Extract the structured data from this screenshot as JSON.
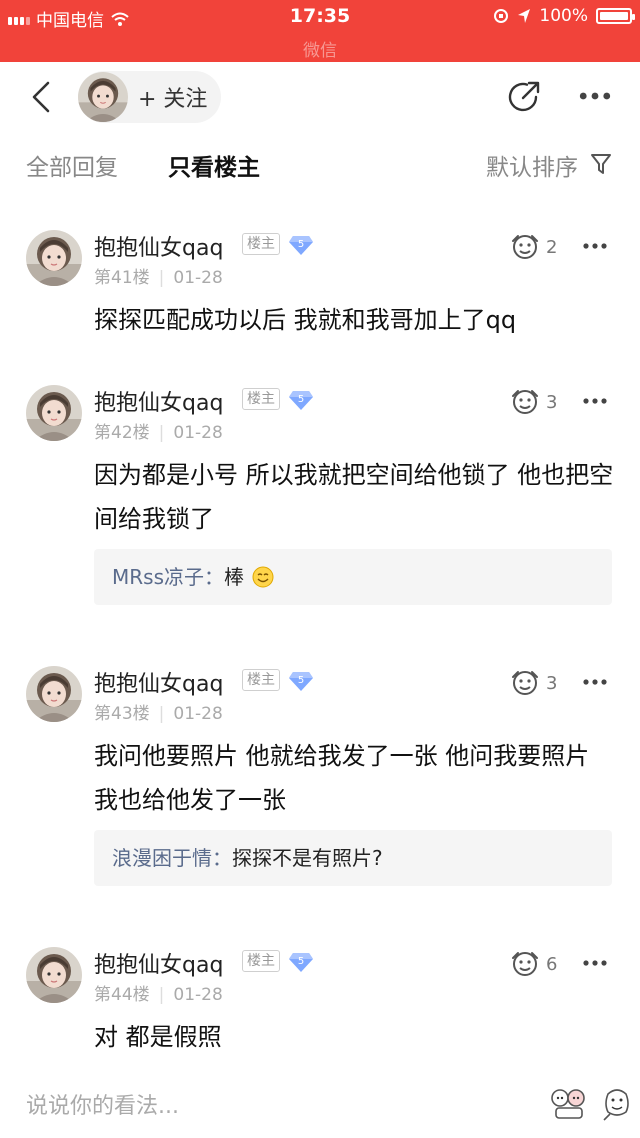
{
  "status_bar": {
    "carrier": "中国电信",
    "time": "17:35",
    "battery": "100%",
    "faded_title": "微信"
  },
  "header": {
    "follow_label": "+ 关注"
  },
  "tabs": {
    "all": "全部回复",
    "op_only": "只看楼主",
    "sort": "默认排序"
  },
  "posts": [
    {
      "username": "抱抱仙女qaq",
      "tag": "楼主",
      "level": "5",
      "floor": "第41楼",
      "date": "01-28",
      "likes": "2",
      "content": "探探匹配成功以后 我就和我哥加上了qq"
    },
    {
      "username": "抱抱仙女qaq",
      "tag": "楼主",
      "level": "5",
      "floor": "第42楼",
      "date": "01-28",
      "likes": "3",
      "content": "因为都是小号 所以我就把空间给他锁了 他也把空间给我锁了",
      "reply": {
        "name": "MRss凉子：",
        "text": "棒"
      }
    },
    {
      "username": "抱抱仙女qaq",
      "tag": "楼主",
      "level": "5",
      "floor": "第43楼",
      "date": "01-28",
      "likes": "3",
      "content": "我问他要照片 他就给我发了一张 他问我要照片 我也给他发了一张",
      "reply": {
        "name": "浪漫困于情：",
        "text": "探探不是有照片?"
      }
    },
    {
      "username": "抱抱仙女qaq",
      "tag": "楼主",
      "level": "5",
      "floor": "第44楼",
      "date": "01-28",
      "likes": "6",
      "content": "对 都是假照"
    }
  ],
  "comment_input": {
    "placeholder": "说说你的看法..."
  },
  "colors": {
    "status_bar": "#f1433a",
    "reply_name": "#5a6b8c",
    "level_badge": "#7fa8ff"
  }
}
